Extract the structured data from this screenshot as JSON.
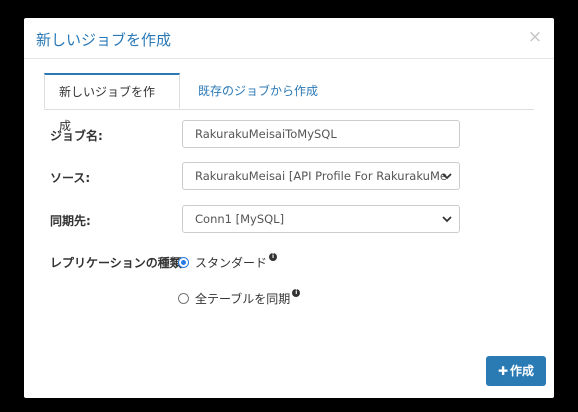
{
  "modal": {
    "title": "新しいジョブを作成",
    "close_label": "×"
  },
  "tabs": [
    {
      "label": "新しいジョブを作成",
      "active": true
    },
    {
      "label": "既存のジョブから作成",
      "active": false
    }
  ],
  "form": {
    "job_name": {
      "label": "ジョブ名:",
      "value": "RakurakuMeisaiToMySQL"
    },
    "source": {
      "label": "ソース:",
      "value": "RakurakuMeisai [API Profile For RakurakuMeis"
    },
    "destination": {
      "label": "同期先:",
      "value": "Conn1 [MySQL]"
    },
    "replication_type": {
      "label": "レプリケーションの種類:",
      "options": [
        {
          "label": "スタンダード",
          "checked": true
        },
        {
          "label": "全テーブルを同期",
          "checked": false
        }
      ]
    }
  },
  "footer": {
    "create_label": "作成",
    "create_icon": "plus-icon"
  },
  "colors": {
    "accent": "#2a79b6",
    "button": "#2a7ab4",
    "radio": "#2a7ae2"
  }
}
